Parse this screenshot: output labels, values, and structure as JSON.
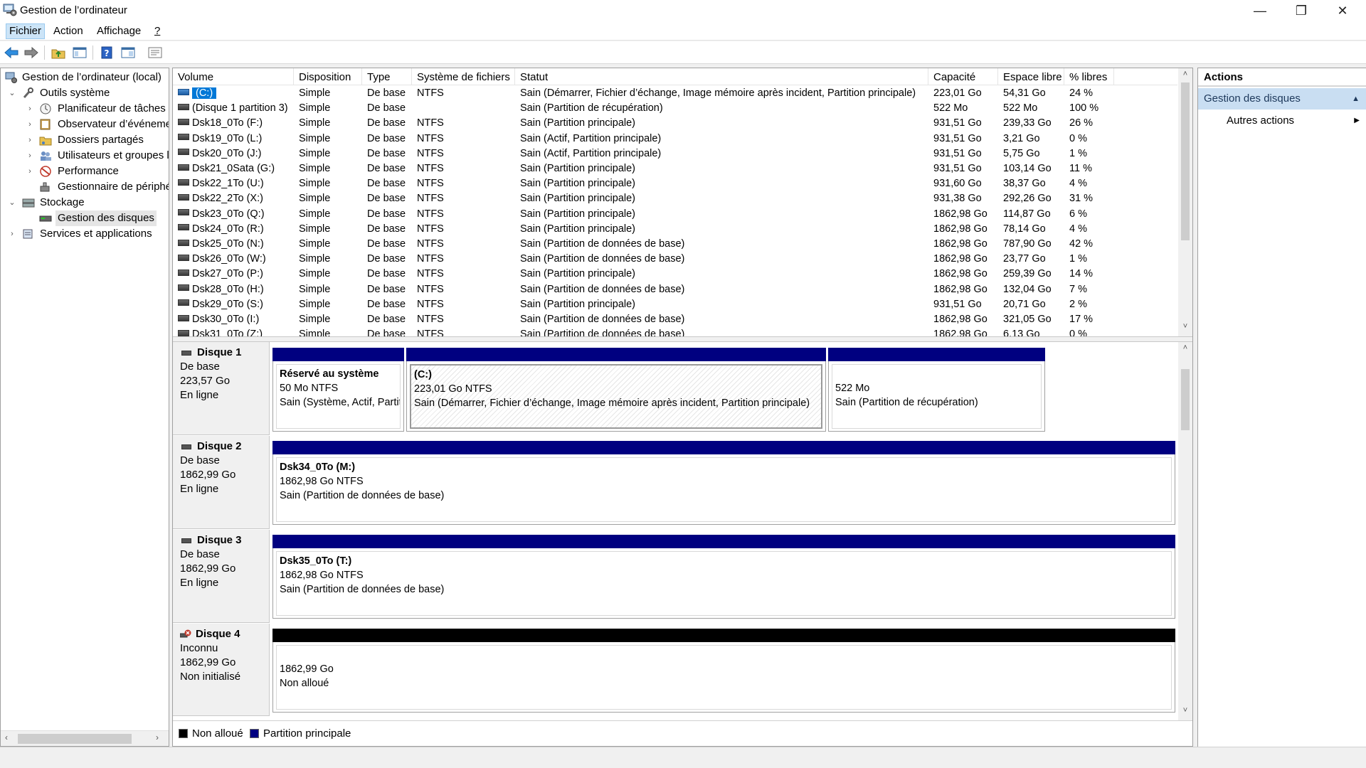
{
  "window": {
    "title": "Gestion de l’ordinateur",
    "minimize": "—",
    "restore": "❐",
    "close": "✕"
  },
  "menu": [
    {
      "label": "Fichier"
    },
    {
      "label": "Action"
    },
    {
      "label": "Affichage"
    },
    {
      "label": "?"
    }
  ],
  "toolbar": {
    "icons": [
      "back-arrow-icon",
      "forward-arrow-icon",
      "up-folder-icon",
      "show-hide-tree-icon",
      "help-icon",
      "properties-icon",
      "view-icon"
    ]
  },
  "tree": {
    "root": "Gestion de l’ordinateur (local)",
    "items": [
      {
        "label": "Outils système",
        "expander": "⌄"
      },
      {
        "label": "Planificateur de tâches",
        "expander": "›"
      },
      {
        "label": "Observateur d’événements",
        "expander": "›"
      },
      {
        "label": "Dossiers partagés",
        "expander": "›"
      },
      {
        "label": "Utilisateurs et groupes locaux",
        "expander": "›"
      },
      {
        "label": "Performance",
        "expander": "›"
      },
      {
        "label": "Gestionnaire de périphériques",
        "expander": ""
      },
      {
        "label": "Stockage",
        "expander": "⌄"
      },
      {
        "label": "Gestion des disques",
        "expander": ""
      },
      {
        "label": "Services et applications",
        "expander": "›"
      }
    ],
    "scroll_left": "‹",
    "scroll_right": "›"
  },
  "volumes": {
    "columns": [
      "Volume",
      "Disposition",
      "Type",
      "Système de fichiers",
      "Statut",
      "Capacité",
      "Espace libre",
      "% libres"
    ],
    "rows": [
      [
        "(C:)",
        "Simple",
        "De base",
        "NTFS",
        "Sain (Démarrer, Fichier d’échange, Image mémoire après incident, Partition principale)",
        "223,01 Go",
        "54,31 Go",
        "24 %"
      ],
      [
        "(Disque 1 partition 3)",
        "Simple",
        "De base",
        "",
        "Sain (Partition de récupération)",
        "522 Mo",
        "522 Mo",
        "100 %"
      ],
      [
        "Dsk18_0To (F:)",
        "Simple",
        "De base",
        "NTFS",
        "Sain (Partition principale)",
        "931,51 Go",
        "239,33 Go",
        "26 %"
      ],
      [
        "Dsk19_0To (L:)",
        "Simple",
        "De base",
        "NTFS",
        "Sain (Actif, Partition principale)",
        "931,51 Go",
        "3,21 Go",
        "0 %"
      ],
      [
        "Dsk20_0To (J:)",
        "Simple",
        "De base",
        "NTFS",
        "Sain (Actif, Partition principale)",
        "931,51 Go",
        "5,75 Go",
        "1 %"
      ],
      [
        "Dsk21_0Sata (G:)",
        "Simple",
        "De base",
        "NTFS",
        "Sain (Partition principale)",
        "931,51 Go",
        "103,14 Go",
        "11 %"
      ],
      [
        "Dsk22_1To (U:)",
        "Simple",
        "De base",
        "NTFS",
        "Sain (Partition principale)",
        "931,60 Go",
        "38,37 Go",
        "4 %"
      ],
      [
        "Dsk22_2To (X:)",
        "Simple",
        "De base",
        "NTFS",
        "Sain (Partition principale)",
        "931,38 Go",
        "292,26 Go",
        "31 %"
      ],
      [
        "Dsk23_0To (Q:)",
        "Simple",
        "De base",
        "NTFS",
        "Sain (Partition principale)",
        "1862,98 Go",
        "114,87 Go",
        "6 %"
      ],
      [
        "Dsk24_0To (R:)",
        "Simple",
        "De base",
        "NTFS",
        "Sain (Partition principale)",
        "1862,98 Go",
        "78,14 Go",
        "4 %"
      ],
      [
        "Dsk25_0To (N:)",
        "Simple",
        "De base",
        "NTFS",
        "Sain (Partition de données de base)",
        "1862,98 Go",
        "787,90 Go",
        "42 %"
      ],
      [
        "Dsk26_0To (W:)",
        "Simple",
        "De base",
        "NTFS",
        "Sain (Partition de données de base)",
        "1862,98 Go",
        "23,77 Go",
        "1 %"
      ],
      [
        "Dsk27_0To (P:)",
        "Simple",
        "De base",
        "NTFS",
        "Sain (Partition principale)",
        "1862,98 Go",
        "259,39 Go",
        "14 %"
      ],
      [
        "Dsk28_0To (H:)",
        "Simple",
        "De base",
        "NTFS",
        "Sain (Partition de données de base)",
        "1862,98 Go",
        "132,04 Go",
        "7 %"
      ],
      [
        "Dsk29_0To (S:)",
        "Simple",
        "De base",
        "NTFS",
        "Sain (Partition principale)",
        "931,51 Go",
        "20,71 Go",
        "2 %"
      ],
      [
        "Dsk30_0To (I:)",
        "Simple",
        "De base",
        "NTFS",
        "Sain (Partition de données de base)",
        "1862,98 Go",
        "321,05 Go",
        "17 %"
      ],
      [
        "Dsk31_0To (Z:)",
        "Simple",
        "De base",
        "NTFS",
        "Sain (Partition de données de base)",
        "1862,98 Go",
        "6,13 Go",
        "0 %"
      ]
    ],
    "scroll_up": "˄",
    "scroll_down": "˅"
  },
  "disks": [
    {
      "name": "Disque 1",
      "type": "De base",
      "size": "223,57 Go",
      "state": "En ligne",
      "status_icon": "disk-icon",
      "partitions": [
        {
          "title": "Réservé au système",
          "line1": "50 Mo NTFS",
          "line2": "Sain (Système, Actif, Partition principale)",
          "selected": false
        },
        {
          "title": "(C:)",
          "line1": "223,01 Go NTFS",
          "line2": "Sain (Démarrer, Fichier d’échange, Image mémoire après incident, Partition principale)",
          "selected": true
        },
        {
          "title": "",
          "line1": "522 Mo",
          "line2": "Sain (Partition de récupération)",
          "selected": false
        }
      ]
    },
    {
      "name": "Disque 2",
      "type": "De base",
      "size": "1862,99 Go",
      "state": "En ligne",
      "status_icon": "disk-icon",
      "partitions": [
        {
          "title": "Dsk34_0To  (M:)",
          "line1": "1862,98 Go NTFS",
          "line2": "Sain (Partition de données de base)",
          "selected": false
        }
      ]
    },
    {
      "name": "Disque 3",
      "type": "De base",
      "size": "1862,99 Go",
      "state": "En ligne",
      "status_icon": "disk-icon",
      "partitions": [
        {
          "title": "Dsk35_0To  (T:)",
          "line1": "1862,98 Go NTFS",
          "line2": "Sain (Partition de données de base)",
          "selected": false
        }
      ]
    },
    {
      "name": "Disque 4",
      "type": "Inconnu",
      "size": "1862,99 Go",
      "state": "Non initialisé",
      "status_icon": "disk-error-icon",
      "partitions": [
        {
          "title": "",
          "line1": "1862,99 Go",
          "line2": "Non alloué",
          "selected": false,
          "unallocated": true
        }
      ]
    }
  ],
  "legend": [
    {
      "label": "Non alloué",
      "color": "#000000"
    },
    {
      "label": "Partition principale",
      "color": "#000080"
    }
  ],
  "actions": {
    "header": "Actions",
    "section": "Gestion des disques",
    "section_caret": "▲",
    "item": "Autres actions",
    "item_caret": "▶"
  },
  "colors": {
    "primary_partition": "#000080",
    "unallocated": "#000000",
    "selection": "#0078d7",
    "actions_section_bg": "#c9def2"
  }
}
